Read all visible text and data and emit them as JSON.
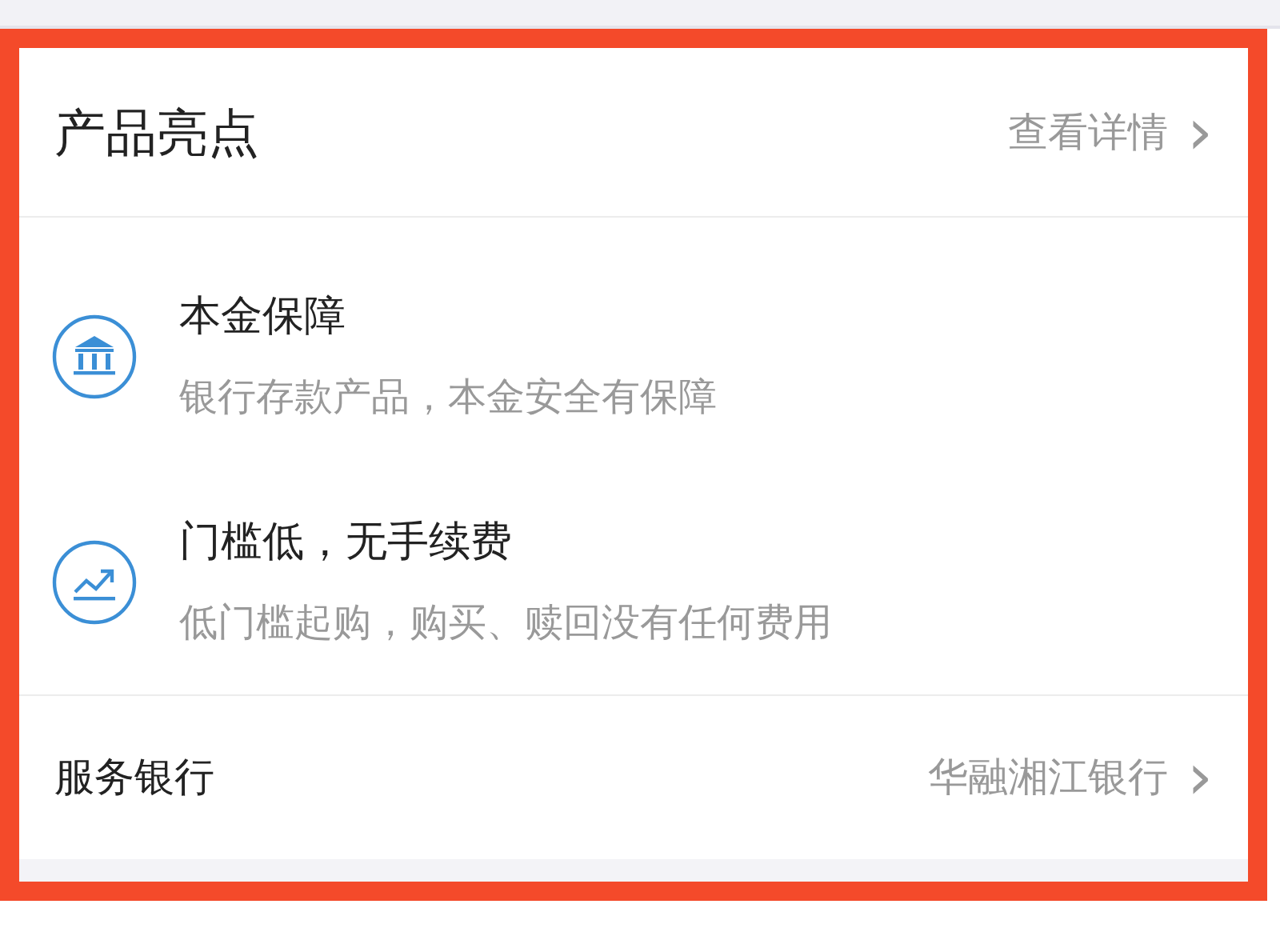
{
  "header": {
    "title": "产品亮点",
    "link": "查看详情",
    "chevron": "›"
  },
  "features": [
    {
      "kind": "bank",
      "title": "本金保障",
      "description": "银行存款产品，本金安全有保障"
    },
    {
      "kind": "trend",
      "title": "门槛低，无手续费",
      "description": "低门槛起购，购买、赎回没有任何费用"
    }
  ],
  "service": {
    "label": "服务银行",
    "value": "华融湘江银行",
    "chevron": "›"
  }
}
